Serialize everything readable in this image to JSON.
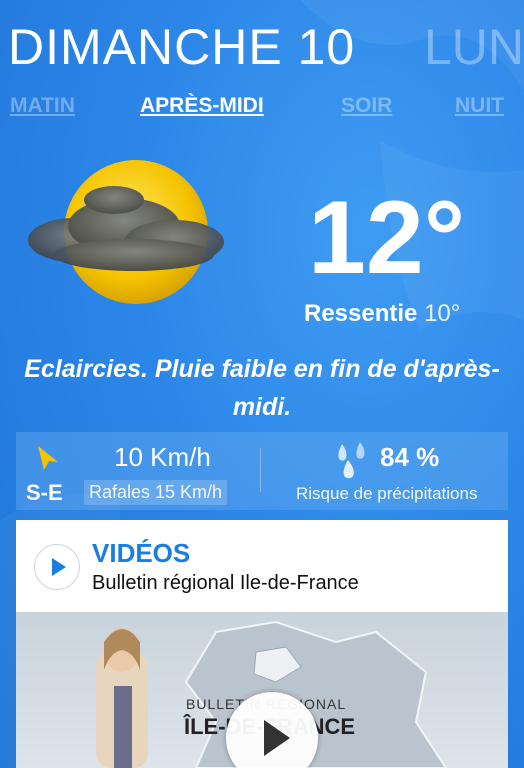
{
  "days": {
    "current": "DIMANCHE 10",
    "next": "LUN"
  },
  "tabs": [
    {
      "label": "MATIN",
      "active": false
    },
    {
      "label": "APRÈS-MIDI",
      "active": true
    },
    {
      "label": "SOIR",
      "active": false
    },
    {
      "label": "NUIT",
      "active": false
    }
  ],
  "weather": {
    "icon": "sun-behind-cloud-icon",
    "temperature": "12°",
    "feels_label": "Ressentie",
    "feels_value": "10°",
    "description": "Eclaircies. Pluie faible en fin de d'après-midi."
  },
  "wind": {
    "speed": "10 Km/h",
    "direction": "S-E",
    "gusts": "Rafales 15 Km/h",
    "icon": "wind-arrow-icon"
  },
  "precipitation": {
    "value": "84 %",
    "label": "Risque de précipitations",
    "icon": "rain-drops-icon"
  },
  "video": {
    "title": "VIDÉOS",
    "subtitle": "Bulletin régional Ile-de-France",
    "thumb_label": "BULLETIN RÉGIONAL",
    "thumb_region": "ÎLE-DE-FRANCE"
  },
  "colors": {
    "background": "#2c86e8",
    "accent": "#1a7de0",
    "sun": "#f5c400"
  }
}
